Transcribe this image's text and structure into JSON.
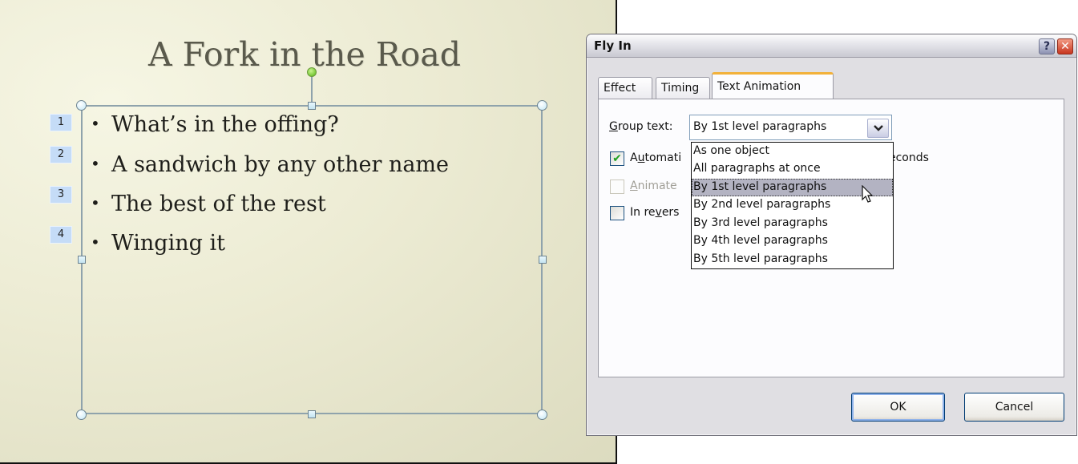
{
  "slide": {
    "title": "A Fork in the Road",
    "bullets": [
      {
        "tag": "1",
        "text": "What’s in the offing?"
      },
      {
        "tag": "2",
        "text": "A sandwich by any other name"
      },
      {
        "tag": "3",
        "text": "The best of the rest"
      },
      {
        "tag": "4",
        "text": "Winging it"
      }
    ],
    "bullet_glyph": "•"
  },
  "dialog": {
    "title": "Fly In",
    "help_glyph": "?",
    "close_glyph": "✕",
    "tabs": [
      {
        "label": "Effect",
        "active": false
      },
      {
        "label": "Timing",
        "active": false
      },
      {
        "label": "Text Animation",
        "active": true
      }
    ],
    "group_text": {
      "label_accel": "G",
      "label_rest": "roup text:",
      "value": "By 1st level paragraphs",
      "arrow_glyph": "⌄",
      "options": [
        "As one object",
        "All paragraphs at once",
        "By 1st level paragraphs",
        "By 2nd level paragraphs",
        "By 3rd level paragraphs",
        "By 4th level paragraphs",
        "By 5th level paragraphs"
      ],
      "highlighted_index": 2
    },
    "automatically": {
      "checked": true,
      "check_glyph": "✔",
      "label_pre": "A",
      "label_accel": "u",
      "label_post": "tomati",
      "suffix_visible": "econds"
    },
    "animate": {
      "checked": false,
      "disabled": true,
      "label_accel": "A",
      "label_rest": "nimate"
    },
    "reverse": {
      "checked": false,
      "label_pre": "In re",
      "label_accel": "v",
      "label_post": "ers"
    },
    "ok_label": "OK",
    "cancel_label": "Cancel"
  }
}
